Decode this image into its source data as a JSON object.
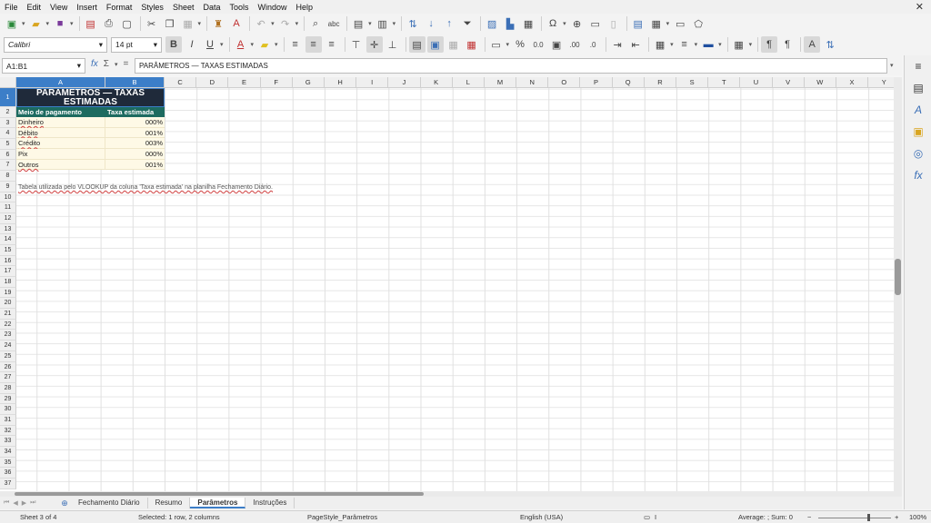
{
  "menu": [
    "File",
    "Edit",
    "View",
    "Insert",
    "Format",
    "Styles",
    "Sheet",
    "Data",
    "Tools",
    "Window",
    "Help"
  ],
  "font": {
    "name": "Calibri",
    "size": "14 pt"
  },
  "formula_bar": {
    "cell_ref": "A1:B1",
    "content": "PARÂMETROS — TAXAS ESTIMADAS",
    "fx": "fx",
    "sum": "Σ",
    "equals": "="
  },
  "columns": [
    "A",
    "B",
    "C",
    "D",
    "E",
    "F",
    "G",
    "H",
    "I",
    "J",
    "K",
    "L",
    "M",
    "N",
    "O",
    "P",
    "Q",
    "R",
    "S",
    "T",
    "U",
    "V",
    "W",
    "X",
    "Y"
  ],
  "rows": [
    "1",
    "2",
    "3",
    "4",
    "5",
    "6",
    "7",
    "8",
    "9",
    "10",
    "11",
    "12",
    "13",
    "14",
    "15",
    "16",
    "17",
    "18",
    "19",
    "20",
    "21",
    "22",
    "23",
    "24",
    "25",
    "26",
    "27",
    "28",
    "29",
    "30",
    "31",
    "32",
    "33",
    "34",
    "35",
    "36",
    "37"
  ],
  "sheet": {
    "title": "PARÂMETROS — TAXAS ESTIMADAS",
    "header": {
      "a": "Meio de pagamento",
      "b": "Taxa estimada"
    },
    "data": [
      {
        "a": "Dinheiro",
        "b": "000%"
      },
      {
        "a": "Débito",
        "b": "001%"
      },
      {
        "a": "Crédito",
        "b": "003%"
      },
      {
        "a": "Pix",
        "b": "000%"
      },
      {
        "a": "Outros",
        "b": "001%"
      }
    ],
    "note": "Tabela utilizada pelo VLOOKUP da coluna 'Taxa estimada' na planilha Fechamento Diário."
  },
  "tabs": [
    {
      "label": "Fechamento Diário",
      "active": false
    },
    {
      "label": "Resumo",
      "active": false
    },
    {
      "label": "Parâmetros",
      "active": true
    },
    {
      "label": "Instruções",
      "active": false
    }
  ],
  "status": {
    "sheet": "Sheet 3 of 4",
    "selection": "Selected: 1 row, 2 columns",
    "page_style": "PageStyle_Parâmetros",
    "language": "English (USA)",
    "sum": "Average: ; Sum: 0",
    "zoom": "100%"
  }
}
